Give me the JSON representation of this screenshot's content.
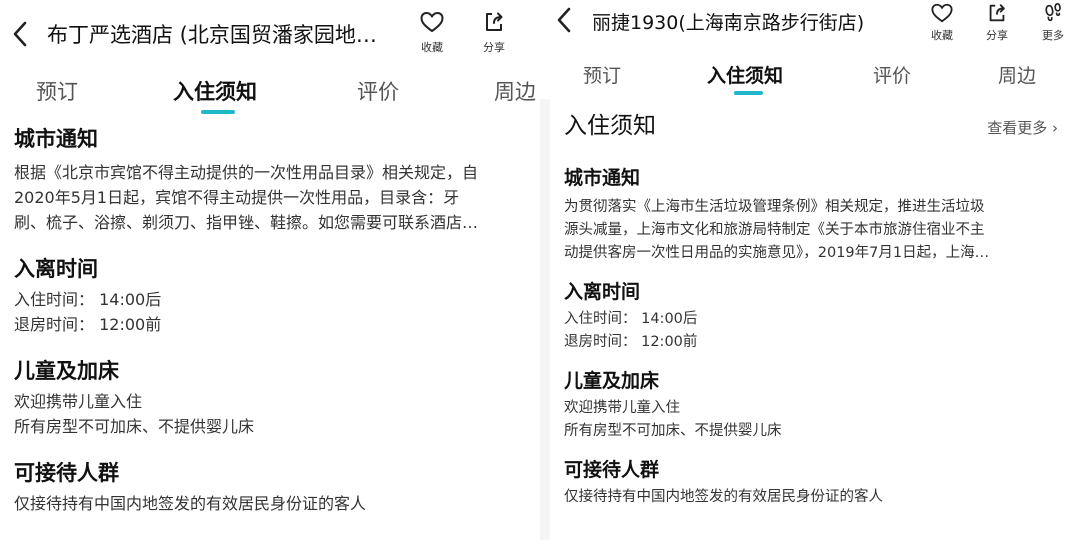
{
  "left": {
    "header": {
      "title": "布丁严选酒店 (北京国贸潘家园地…",
      "actions": [
        {
          "icon": "heart-icon",
          "label": "收藏"
        },
        {
          "icon": "share-icon",
          "label": "分享"
        }
      ]
    },
    "tabs": [
      "预订",
      "入住须知",
      "评价",
      "周边"
    ],
    "active_tab": "入住须知",
    "sections": {
      "city_notice": {
        "title": "城市通知",
        "lines": [
          "根据《北京市宾馆不得主动提供的一次性用品目录》相关规定，自",
          "2020年5月1日起，宾馆不得主动提供一次性用品，目录含：牙",
          "刷、梳子、浴擦、剃须刀、指甲锉、鞋擦。如您需要可联系酒店…"
        ]
      },
      "checkin_time": {
        "title": "入离时间",
        "lines": [
          "入住时间：  14:00后",
          "退房时间：  12:00前"
        ]
      },
      "children": {
        "title": "儿童及加床",
        "lines": [
          "欢迎携带儿童入住",
          "所有房型不可加床、不提供婴儿床"
        ]
      },
      "guests": {
        "title": "可接待人群",
        "lines": [
          "仅接待持有中国内地签发的有效居民身份证的客人"
        ]
      }
    }
  },
  "right": {
    "header": {
      "title": "丽捷1930(上海南京路步行街店)",
      "actions": [
        {
          "icon": "heart-icon",
          "label": "收藏"
        },
        {
          "icon": "share-icon",
          "label": "分享"
        },
        {
          "icon": "footprint-icon",
          "label": "更多"
        }
      ]
    },
    "tabs": [
      "预订",
      "入住须知",
      "评价",
      "周边"
    ],
    "active_tab": "入住须知",
    "card": {
      "title": "入住须知",
      "more": "查看更多 ›"
    },
    "sections": {
      "city_notice": {
        "title": "城市通知",
        "lines": [
          "为贯彻落实《上海市生活垃圾管理条例》相关规定，推进生活垃圾",
          "源头减量，上海市文化和旅游局特制定《关于本市旅游住宿业不主",
          "动提供客房一次性日用品的实施意见》，2019年7月1日起，上海…"
        ]
      },
      "checkin_time": {
        "title": "入离时间",
        "lines": [
          "入住时间：  14:00后",
          "退房时间：  12:00前"
        ]
      },
      "children": {
        "title": "儿童及加床",
        "lines": [
          "欢迎携带儿童入住",
          "所有房型不可加床、不提供婴儿床"
        ]
      },
      "guests": {
        "title": "可接待人群",
        "lines": [
          "仅接待持有中国内地签发的有效居民身份证的客人"
        ]
      }
    }
  },
  "colors": {
    "accent": "#1fb7c9",
    "right_background": "#f5f5f5"
  }
}
